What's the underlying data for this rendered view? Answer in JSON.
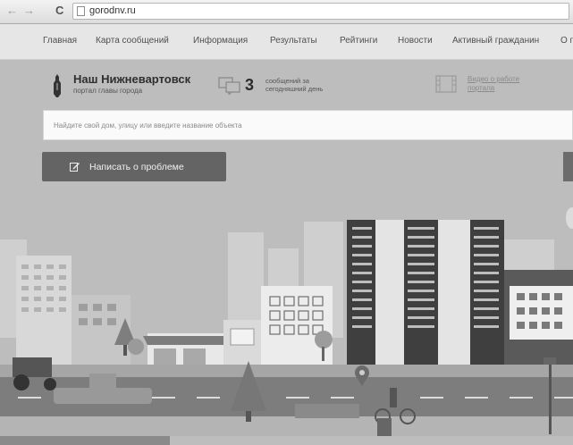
{
  "browser": {
    "back_icon": "arrow-left-icon",
    "forward_icon": "arrow-right-icon",
    "reload_icon": "reload-icon",
    "back_glyph": "←",
    "forward_glyph": "→",
    "reload_glyph": "C",
    "url": "gorodnv.ru"
  },
  "nav": {
    "items": [
      {
        "label": "Главная"
      },
      {
        "label": "Карта сообщений"
      },
      {
        "label": "Информация"
      },
      {
        "label": "Результаты"
      },
      {
        "label": "Рейтинги"
      },
      {
        "label": "Новости"
      },
      {
        "label": "Активный гражданин"
      },
      {
        "label": "О г"
      }
    ]
  },
  "header": {
    "title": "Наш Нижневартовск",
    "subtitle": "портал главы города",
    "message_count": "3",
    "message_text": "сообщений за\nсегодняшний день",
    "video_link": "Видео о работе\nпортала"
  },
  "search": {
    "placeholder": "Найдите свой дом, улицу или введите название объекта"
  },
  "write_button": {
    "label": "Написать о проблеме"
  },
  "colors": {
    "sky": "#bdbdbd",
    "nav_bg": "#e6e6e6",
    "button": "#646464"
  }
}
